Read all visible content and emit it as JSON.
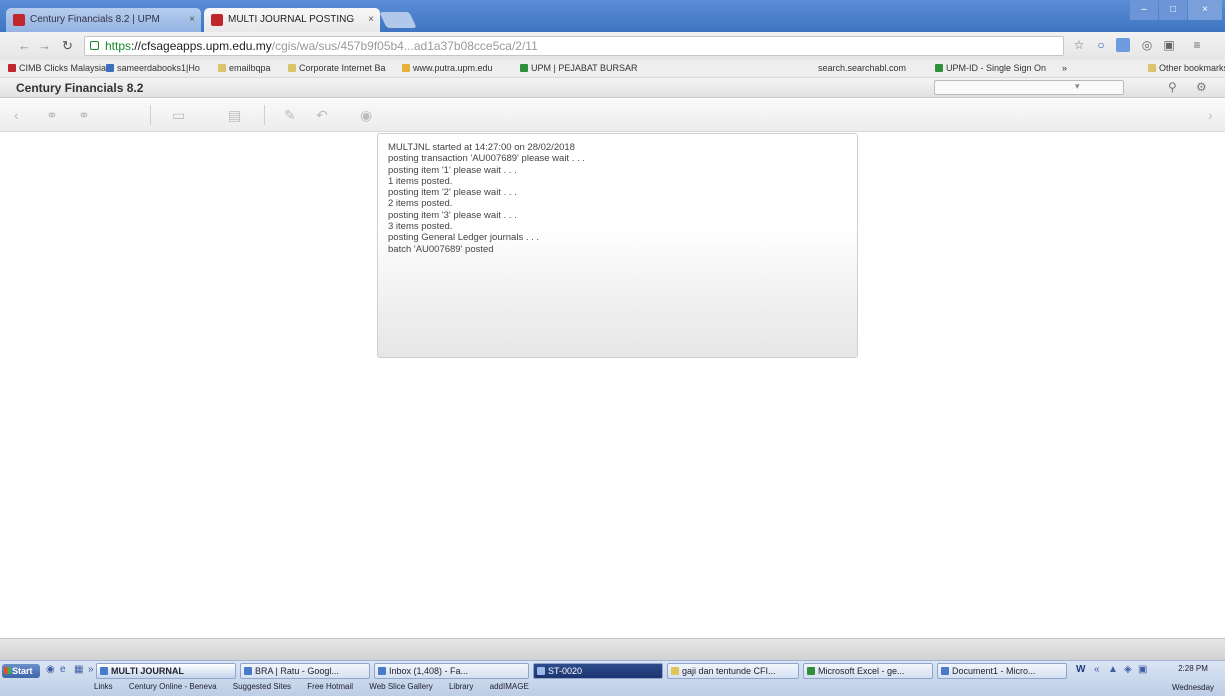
{
  "browser": {
    "tabs": [
      {
        "label": "Century Financials 8.2 | UPM",
        "active": false
      },
      {
        "label": "MULTI JOURNAL POSTING",
        "active": true
      }
    ],
    "window_controls": [
      "–",
      "□",
      "×"
    ],
    "url": {
      "scheme": "https",
      "host": "://cfsageapps.upm.edu.my",
      "path": "/cgis/wa/sus/457b9f05b4...ad1a37b08cce5ca/2/11"
    },
    "bookmarks": [
      "CIMB Clicks Malaysia",
      "sameerdabooks1|Ho",
      "emailbqpa",
      "Corporate Internet Ba",
      "www.putra.upm.edu",
      "UPM | PEJABAT BURSAR",
      "search.searchabl.com",
      "UPM-ID - Single Sign On",
      "Other bookmarks"
    ],
    "icons": [
      "star-icon",
      "extension-icon",
      "menu-icon"
    ]
  },
  "app": {
    "title": "Century Financials 8.2",
    "search_arrow": "▾"
  },
  "log": {
    "lines": [
      "MULTJNL  started at 14:27:00 on 28/02/2018",
      "posting transaction 'AU007689' please wait . . .",
      "posting item '1' please wait . . .",
      "1 items posted.",
      "posting item '2' please wait . . .",
      "2 items posted.",
      "posting item '3' please wait . . .",
      "3 items posted.",
      "posting General Ledger journals . . .",
      "batch 'AU007689' posted"
    ]
  },
  "taskbar": {
    "start": "Start",
    "tasks": [
      {
        "label": "MULTI JOURNAL",
        "style": "active"
      },
      {
        "label": "BRA | Ratu - Googl...",
        "style": "normal"
      },
      {
        "label": "Inbox (1,408) - Fa...",
        "style": "normal"
      },
      {
        "label": "ST-0020",
        "style": "dark"
      },
      {
        "label": "gaji dan tentunde CFI...",
        "style": "normal"
      },
      {
        "label": "Microsoft Excel - ge...",
        "style": "normal"
      },
      {
        "label": "Document1 - Micro...",
        "style": "normal"
      }
    ],
    "links": [
      "Links",
      "Century Online - Beneva",
      "Suggested Sites",
      "Free Hotmail",
      "Web Slice Gallery",
      "Library",
      "addIMAGE"
    ],
    "clock": {
      "time": "2:28 PM",
      "day": "Wednesday"
    }
  }
}
